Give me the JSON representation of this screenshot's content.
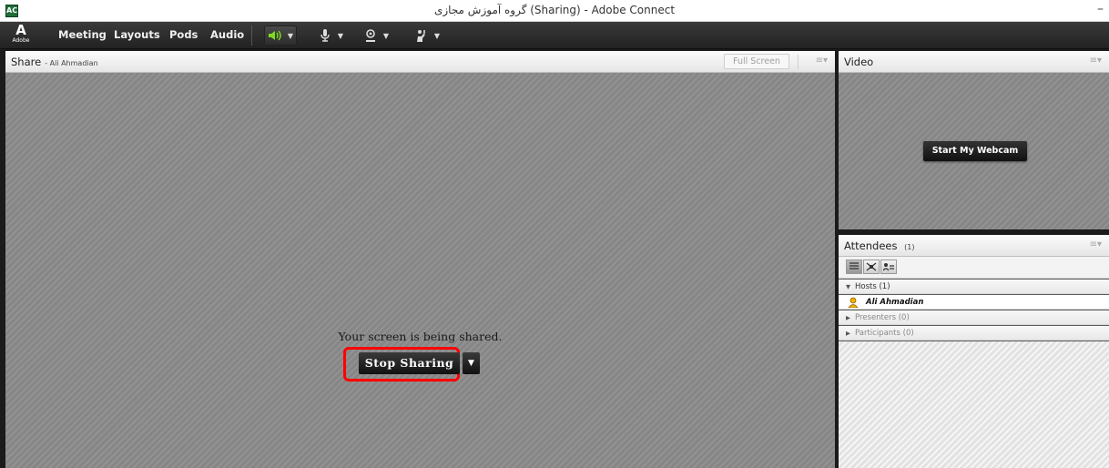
{
  "window": {
    "title": "گروه آموزش مجازی (Sharing) - Adobe Connect",
    "minimize_glyph": "–"
  },
  "app_icon": {
    "label": "AC"
  },
  "menubar": {
    "logo_mark": "A",
    "logo_word": "Adobe",
    "items": [
      "Meeting",
      "Layouts",
      "Pods",
      "Audio"
    ],
    "toolbar_icons": [
      "speaker-icon",
      "microphone-icon",
      "webcam-icon",
      "raise-hand-icon"
    ],
    "speaker_color": "#7ddc1f"
  },
  "share_pod": {
    "title": "Share",
    "subtitle": "- Ali Ahmadian",
    "full_screen_label": "Full Screen",
    "menu_glyph": "≡▾",
    "message": "Your screen is being shared.",
    "stop_button_label": "Stop Sharing",
    "highlight_color": "#ff0000"
  },
  "video_pod": {
    "title": "Video",
    "menu_glyph": "≡▾",
    "webcam_button_label": "Start My Webcam"
  },
  "attendees_pod": {
    "title": "Attendees",
    "count": "(1)",
    "menu_glyph": "≡▾",
    "views": [
      "list-view-icon",
      "grid-view-icon",
      "status-view-icon"
    ],
    "groups": [
      {
        "label": "Hosts (1)",
        "expanded": true
      },
      {
        "label": "Presenters (0)",
        "expanded": false
      },
      {
        "label": "Participants (0)",
        "expanded": false
      }
    ],
    "host_user": "Ali Ahmadian"
  }
}
